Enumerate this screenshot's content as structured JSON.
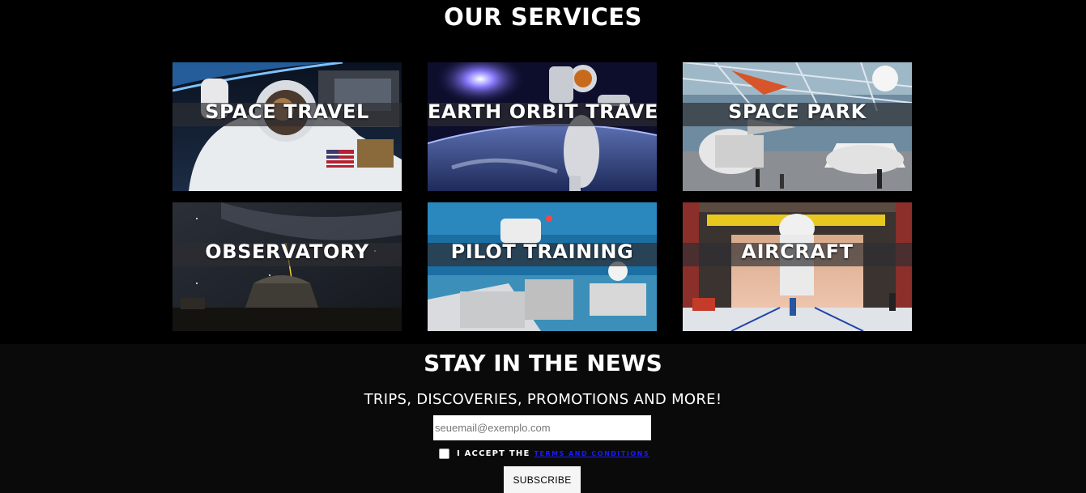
{
  "services": {
    "title": "OUR SERVICES",
    "cards": [
      {
        "label": "SPACE TRAVEL"
      },
      {
        "label": "EARTH ORBIT TRAVEL"
      },
      {
        "label": "SPACE PARK"
      },
      {
        "label": "OBSERVATORY"
      },
      {
        "label": "PILOT TRAINING"
      },
      {
        "label": "AIRCRAFT"
      }
    ]
  },
  "newsletter": {
    "title": "STAY IN THE NEWS",
    "subtitle": "TRIPS, DISCOVERIES, PROMOTIONS AND MORE!",
    "email_placeholder": "seuemail@exemplo.com",
    "email_value": "",
    "accept_text": "I ACCEPT THE",
    "terms_link": "TERMS AND CONDITIONS",
    "subscribe_label": "SUBSCRIBE"
  },
  "colors": {
    "page_background": "#000000",
    "newsletter_background": "#0a0a0a",
    "link": "#1a1aff"
  }
}
